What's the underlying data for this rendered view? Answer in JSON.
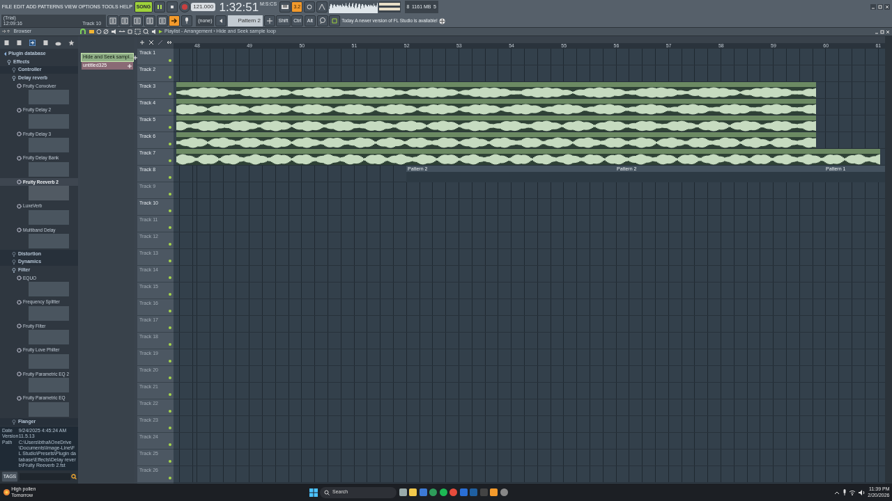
{
  "menu": [
    "FILE",
    "EDIT",
    "ADD",
    "PATTERNS",
    "VIEW",
    "OPTIONS",
    "TOOLS",
    "HELP"
  ],
  "hint_panel": {
    "mode": "(Trial)",
    "clock": "12:09:16",
    "focus": "Track 10"
  },
  "transport": {
    "song_mode": {
      "label": "SONG",
      "on": true
    },
    "playing": true,
    "recording": false,
    "tempo": "121.000",
    "time": "1:32:51",
    "time_unit": "M:S:CS",
    "countdown": {
      "label": "3.2",
      "on": true
    }
  },
  "memory": {
    "cpu": "8",
    "ram": "1161 MB",
    "polyphony": "5"
  },
  "toolbar": {
    "pattern_picker": "(none)",
    "pattern": "Pattern 2",
    "keys": [
      "Shift",
      "Ctrl",
      "Alt"
    ],
    "snap_on": true,
    "news": {
      "title": "Today",
      "text": "A newer version of FL Studio is available!"
    }
  },
  "browser": {
    "title": "Browser",
    "tree": [
      {
        "label": "Plugin database",
        "kind": "folder",
        "expanded": true,
        "children": [
          {
            "label": "Effects",
            "kind": "folder",
            "expanded": true,
            "children": [
              {
                "label": "Controller",
                "kind": "folder",
                "expanded": false
              },
              {
                "label": "Delay reverb",
                "kind": "folder",
                "expanded": true,
                "children": [
                  {
                    "label": "Fruity Convolver",
                    "kind": "plugin",
                    "selected": false
                  },
                  {
                    "label": "Fruity Delay 2",
                    "kind": "plugin",
                    "selected": false
                  },
                  {
                    "label": "Fruity Delay 3",
                    "kind": "plugin",
                    "selected": false
                  },
                  {
                    "label": "Fruity Delay Bank",
                    "kind": "plugin",
                    "selected": false
                  },
                  {
                    "label": "Fruity Reeverb 2",
                    "kind": "plugin",
                    "selected": true
                  },
                  {
                    "label": "LuxeVerb",
                    "kind": "plugin",
                    "selected": false
                  },
                  {
                    "label": "Multiband Delay",
                    "kind": "plugin",
                    "selected": false
                  }
                ]
              },
              {
                "label": "Distortion",
                "kind": "folder",
                "expanded": false
              },
              {
                "label": "Dynamics",
                "kind": "folder",
                "expanded": false
              },
              {
                "label": "Filter",
                "kind": "folder",
                "expanded": true,
                "children": [
                  {
                    "label": "EQUO",
                    "kind": "plugin",
                    "selected": false
                  },
                  {
                    "label": "Frequency Splitter",
                    "kind": "plugin",
                    "selected": false
                  },
                  {
                    "label": "Fruity Filter",
                    "kind": "plugin",
                    "selected": false
                  },
                  {
                    "label": "Fruity Love Philter",
                    "kind": "plugin",
                    "selected": false
                  },
                  {
                    "label": "Fruity Parametric EQ 2",
                    "kind": "plugin",
                    "selected": false
                  },
                  {
                    "label": "Fruity Parametric EQ",
                    "kind": "plugin",
                    "selected": false
                  }
                ]
              },
              {
                "label": "Flanger",
                "kind": "folder",
                "expanded": false
              }
            ]
          }
        ]
      }
    ],
    "info": [
      {
        "key": "Date",
        "value": "9/24/2025 4:45:24 AM"
      },
      {
        "key": "Version",
        "value": "11.5.13"
      },
      {
        "key": "Path",
        "value": "C:\\Users\\bthal\\OneDrive\\Documents\\Image-Line\\FL Studio\\Presets\\Plugin database\\Effects\\Delay reverb\\Fruity Reeverb 2.fst"
      }
    ],
    "tags_label": "TAGS"
  },
  "playlist": {
    "title": "Playlist - Arrangement",
    "separator": "›",
    "song": "Hide and Seek sample loop",
    "picker": [
      {
        "label": "Hide and Seek sampl...",
        "kind": "audio",
        "selected": true
      },
      {
        "label": "untitled325",
        "kind": "pattern",
        "selected": false
      }
    ],
    "ruler": [
      "48",
      "49",
      "50",
      "51",
      "52",
      "53",
      "54",
      "55",
      "56",
      "57",
      "58",
      "59",
      "60",
      "61"
    ],
    "tracks": [
      {
        "name": "Track 1",
        "disabled": false
      },
      {
        "name": "Track 2",
        "disabled": false
      },
      {
        "name": "Track 3",
        "disabled": false,
        "clips": [
          {
            "kind": "audio",
            "open_end": false
          }
        ]
      },
      {
        "name": "Track 4",
        "disabled": false,
        "clips": [
          {
            "kind": "audio",
            "open_end": false
          }
        ]
      },
      {
        "name": "Track 5",
        "disabled": false,
        "clips": [
          {
            "kind": "audio",
            "open_end": false
          }
        ]
      },
      {
        "name": "Track 6",
        "disabled": false,
        "clips": [
          {
            "kind": "audio",
            "open_end": false
          }
        ]
      },
      {
        "name": "Track 7",
        "disabled": false,
        "clips": [
          {
            "kind": "audio",
            "open_end": true
          }
        ]
      },
      {
        "name": "Track 8",
        "disabled": false,
        "clips": [
          {
            "kind": "pattern",
            "label": "Pattern 2"
          },
          {
            "kind": "pattern",
            "label": "Pattern 2"
          },
          {
            "kind": "pattern",
            "label": "Pattern 1"
          }
        ]
      },
      {
        "name": "Track 9",
        "disabled": true
      },
      {
        "name": "Track 10",
        "disabled": false
      },
      {
        "name": "Track 11",
        "disabled": true
      },
      {
        "name": "Track 12",
        "disabled": true
      },
      {
        "name": "Track 13",
        "disabled": true
      },
      {
        "name": "Track 14",
        "disabled": true
      },
      {
        "name": "Track 15",
        "disabled": true
      },
      {
        "name": "Track 16",
        "disabled": true
      },
      {
        "name": "Track 17",
        "disabled": true
      },
      {
        "name": "Track 18",
        "disabled": true
      },
      {
        "name": "Track 19",
        "disabled": true
      },
      {
        "name": "Track 20",
        "disabled": true
      },
      {
        "name": "Track 21",
        "disabled": true
      },
      {
        "name": "Track 22",
        "disabled": true
      },
      {
        "name": "Track 23",
        "disabled": true
      },
      {
        "name": "Track 24",
        "disabled": true
      },
      {
        "name": "Track 25",
        "disabled": true
      },
      {
        "name": "Track 26",
        "disabled": true
      }
    ]
  },
  "taskbar": {
    "weather": {
      "title": "High pollen",
      "subtitle": "Tomorrow"
    },
    "search": "Search",
    "time": "11:39 PM",
    "date": "2/20/2026"
  }
}
